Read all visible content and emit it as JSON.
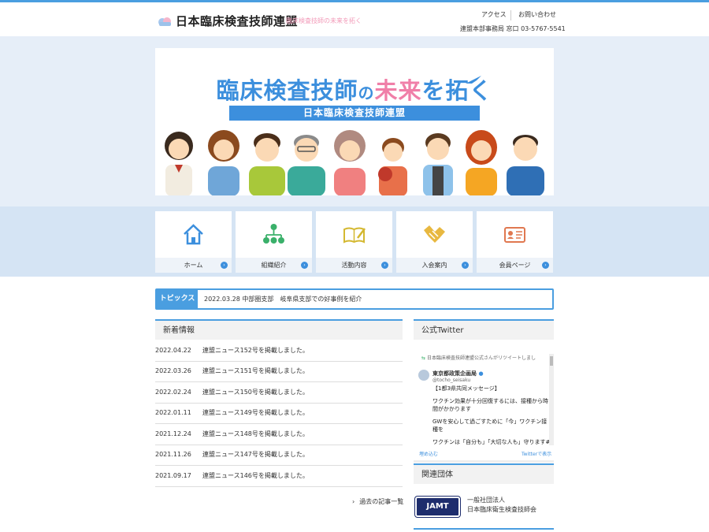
{
  "header": {
    "site_name": "日本臨床検査技師連盟",
    "tagline": "臨床検査技師の未来を拓く",
    "nav": [
      "アクセス",
      "お問い合わせ"
    ],
    "office": "連盟本部事務局 窓口 03-5767-5541"
  },
  "hero": {
    "title_a": "臨床検査技師",
    "title_b": "の",
    "title_c": "未来",
    "title_d": "を拓く",
    "subtitle": "日本臨床検査技師連盟"
  },
  "tiles": [
    {
      "label": "ホーム",
      "icon": "home-icon"
    },
    {
      "label": "組織紹介",
      "icon": "organization-icon"
    },
    {
      "label": "活動内容",
      "icon": "notebook-pen-icon"
    },
    {
      "label": "入会案内",
      "icon": "handshake-icon"
    },
    {
      "label": "会員ページ",
      "icon": "member-card-icon"
    }
  ],
  "topics": {
    "label": "トピックス",
    "text": "2022.03.28 中部圏支部　岐阜県支部での好事例を紹介"
  },
  "news": {
    "title": "新着情報",
    "items": [
      {
        "date": "2022.04.22",
        "text": "連盟ニュース152号を掲載しました。"
      },
      {
        "date": "2022.03.26",
        "text": "連盟ニュース151号を掲載しました。"
      },
      {
        "date": "2022.02.24",
        "text": "連盟ニュース150号を掲載しました。"
      },
      {
        "date": "2022.01.11",
        "text": "連盟ニュース149号を掲載しました。"
      },
      {
        "date": "2021.12.24",
        "text": "連盟ニュース148号を掲載しました。"
      },
      {
        "date": "2021.11.26",
        "text": "連盟ニュース147号を掲載しました。"
      },
      {
        "date": "2021.09.17",
        "text": "連盟ニュース146号を掲載しました。"
      }
    ],
    "more": "過去の記事一覧"
  },
  "twitter": {
    "title": "公式Twitter",
    "retweet": "日本臨床検査技師連盟公式さんがリツイートしまし",
    "name": "東京都政策企画局",
    "handle": "@tocho_seisaku",
    "lines": [
      "【1都3県共同メッセージ】",
      "ワクチン効果が十分回復するには、接種から時",
      "間がかかります",
      "GWを安心して過ごすために「今」ワクチン接",
      "種を",
      "ワクチンは「自分も」「大切な人も」守ります#"
    ],
    "embed": "埋め込む",
    "view": "Twitterで表示"
  },
  "related": {
    "title": "関連団体",
    "logo": "JAMT",
    "org_type": "一般社団法人",
    "org_name": "日本臨床衛生検査技師会"
  },
  "colors": {
    "accent": "#4a9ee0",
    "pink": "#f07fa8",
    "hero_band": "#e6eef8",
    "tiles_band": "#d5e4f4"
  }
}
